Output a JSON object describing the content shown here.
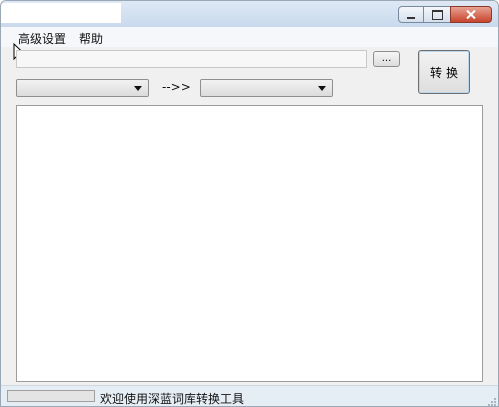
{
  "window": {
    "title": ""
  },
  "menu": {
    "items": [
      {
        "label": "高级设置"
      },
      {
        "label": "帮助"
      }
    ]
  },
  "input": {
    "path_value": "",
    "path_placeholder": "",
    "browse_label": "..."
  },
  "convert": {
    "label": "转换"
  },
  "format": {
    "source_value": "",
    "arrow_label": "-->>",
    "target_value": ""
  },
  "output": {
    "text": ""
  },
  "status": {
    "progress": 0,
    "message": "欢迎使用深蓝词库转换工具"
  }
}
